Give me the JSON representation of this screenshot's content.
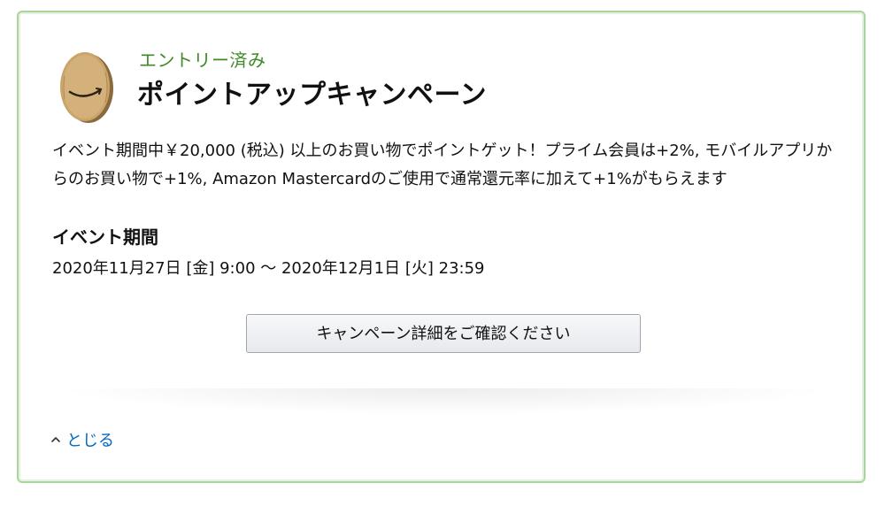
{
  "campaign": {
    "status": "エントリー済み",
    "title": "ポイントアップキャンペーン",
    "description": "イベント期間中￥20,000 (税込) 以上のお買い物でポイントゲット！プライム会員は+2%, モバイルアプリからのお買い物で+1%, Amazon Mastercardのご使用で通常還元率に加えて+1%がもらえます",
    "period_heading": "イベント期間",
    "period_value": "2020年11月27日 [金] 9:00 〜 2020年12月1日 [火] 23:59",
    "detail_button_label": "キャンペーン詳細をご確認ください",
    "close_label": "とじる"
  },
  "colors": {
    "status_green": "#3d8a26",
    "border_green": "#a9d59a",
    "link_blue": "#0066c0"
  },
  "icons": {
    "logo": "amazon-box-coin-icon",
    "close_caret": "chevron-up-icon"
  }
}
